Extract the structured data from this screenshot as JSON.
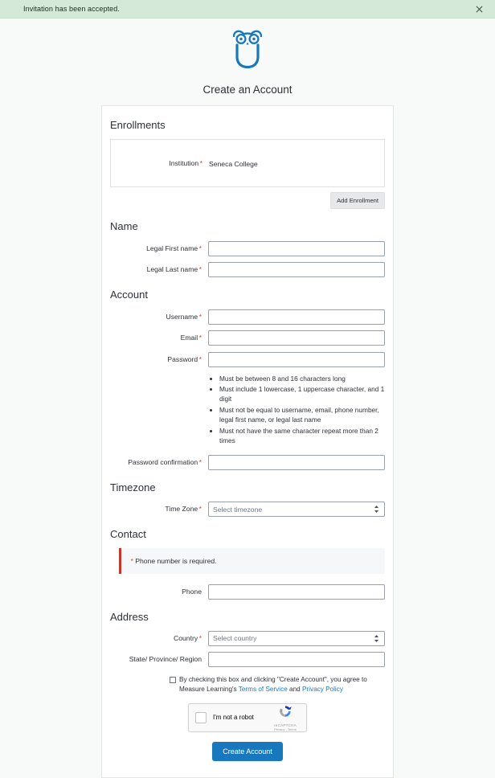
{
  "flash": {
    "message": "Invitation has been accepted.",
    "close_icon": "close-icon",
    "background": "#d4e9d7"
  },
  "header": {
    "logo_icon": "owl-logo-icon",
    "logo_color": "#1878bd",
    "title": "Create an Account"
  },
  "sections": {
    "enrollments": {
      "title": "Enrollments",
      "institution_label": "Institution",
      "institution_required": "*",
      "institution_value": "Seneca College",
      "add_button": "Add Enrollment"
    },
    "name": {
      "title": "Name",
      "first_label": "Legal First name",
      "first_required": "*",
      "first_value": "",
      "last_label": "Legal Last name",
      "last_required": "*",
      "last_value": ""
    },
    "account": {
      "title": "Account",
      "username_label": "Username",
      "username_required": "*",
      "username_value": "",
      "email_label": "Email",
      "email_required": "*",
      "email_value": "",
      "password_label": "Password",
      "password_required": "*",
      "password_value": "",
      "password_rules": [
        "Must be between 8 and 16 characters long",
        "Must include 1 lowercase, 1 uppercase character, and 1 digit",
        "Must not be equal to username, email, phone number, legal first name, or legal last name",
        "Must not have the same character repeat more than 2 times"
      ],
      "confirm_label": "Password confirmation",
      "confirm_required": "*",
      "confirm_value": ""
    },
    "timezone": {
      "title": "Timezone",
      "label": "Time Zone",
      "required": "*",
      "selected": "Select timezone"
    },
    "contact": {
      "title": "Contact",
      "error_star": "*",
      "error_message": " Phone number is required.",
      "error_accent": "#c0392b",
      "phone_label": "Phone",
      "phone_value": ""
    },
    "address": {
      "title": "Address",
      "country_label": "Country",
      "country_required": "*",
      "country_selected": "Select country",
      "state_label": "State/ Province/ Region",
      "state_value": ""
    }
  },
  "consent": {
    "text_before": "By checking this box and clicking \"Create Account\", you agree to Measure Learning's ",
    "terms_link": "Terms of Service",
    "text_middle": " and ",
    "privacy_link": "Privacy Policy",
    "link_color": "#1878bd"
  },
  "captcha": {
    "label": "I'm not a robot",
    "brand": "reCAPTCHA",
    "links": "Privacy - Terms"
  },
  "submit": {
    "label": "Create Account",
    "color": "#1878bd"
  }
}
